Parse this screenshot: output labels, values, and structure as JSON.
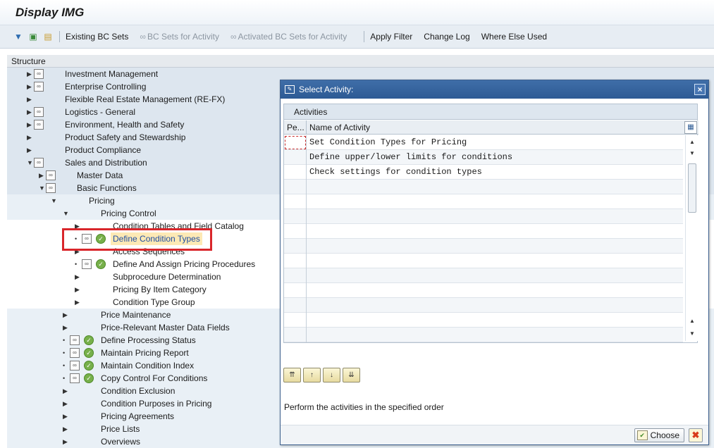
{
  "window": {
    "title": "Display IMG"
  },
  "toolbar": {
    "icons": [
      "expand-icon",
      "find-icon",
      "note-icon"
    ],
    "existing_bc_sets": "Existing BC Sets",
    "bc_sets_for_activity": "BC Sets for Activity",
    "activated_bc_sets": "Activated BC Sets for Activity",
    "apply_filter": "Apply Filter",
    "change_log": "Change Log",
    "where_else_used": "Where Else Used"
  },
  "structure": {
    "header": "Structure",
    "items": [
      {
        "label": "Investment Management",
        "level": 0,
        "icon": true,
        "exec": false,
        "expanded": false
      },
      {
        "label": "Enterprise Controlling",
        "level": 0,
        "icon": true,
        "exec": false,
        "expanded": false
      },
      {
        "label": "Flexible Real Estate Management (RE-FX)",
        "level": 0,
        "icon": false,
        "exec": false,
        "expanded": false
      },
      {
        "label": "Logistics - General",
        "level": 0,
        "icon": true,
        "exec": false,
        "expanded": false
      },
      {
        "label": "Environment, Health and Safety",
        "level": 0,
        "icon": true,
        "exec": false,
        "expanded": false
      },
      {
        "label": "Product Safety and Stewardship",
        "level": 0,
        "icon": false,
        "exec": false,
        "expanded": false
      },
      {
        "label": "Product Compliance",
        "level": 0,
        "icon": false,
        "exec": false,
        "expanded": false
      },
      {
        "label": "Sales and Distribution",
        "level": 0,
        "icon": true,
        "exec": false,
        "expanded": true
      },
      {
        "label": "Master Data",
        "level": 1,
        "icon": true,
        "exec": false,
        "expanded": false
      },
      {
        "label": "Basic Functions",
        "level": 1,
        "icon": true,
        "exec": false,
        "expanded": true
      },
      {
        "label": "Pricing",
        "level": 2,
        "icon": false,
        "exec": false,
        "expanded": true
      },
      {
        "label": "Pricing Control",
        "level": 3,
        "icon": false,
        "exec": false,
        "expanded": true
      },
      {
        "label": "Condition Tables and Field Catalog",
        "level": 4,
        "icon": false,
        "exec": false,
        "expanded": false
      },
      {
        "label": "Define Condition Types",
        "level": 4,
        "icon": true,
        "exec": true,
        "expanded": false,
        "leaf": true,
        "selected": true
      },
      {
        "label": "Access Sequences",
        "level": 4,
        "icon": false,
        "exec": false,
        "expanded": false
      },
      {
        "label": "Define And Assign Pricing Procedures",
        "level": 4,
        "icon": true,
        "exec": true,
        "expanded": false,
        "leaf": true
      },
      {
        "label": "Subprocedure Determination",
        "level": 4,
        "icon": false,
        "exec": false,
        "expanded": false
      },
      {
        "label": "Pricing By Item Category",
        "level": 4,
        "icon": false,
        "exec": false,
        "expanded": false
      },
      {
        "label": "Condition Type Group",
        "level": 4,
        "icon": false,
        "exec": false,
        "expanded": false
      },
      {
        "label": "Price Maintenance",
        "level": 3,
        "icon": false,
        "exec": false,
        "expanded": false
      },
      {
        "label": "Price-Relevant Master Data Fields",
        "level": 3,
        "icon": false,
        "exec": false,
        "expanded": false
      },
      {
        "label": "Define Processing Status",
        "level": 3,
        "icon": true,
        "exec": true,
        "expanded": false,
        "leaf": true
      },
      {
        "label": "Maintain Pricing Report",
        "level": 3,
        "icon": true,
        "exec": true,
        "expanded": false,
        "leaf": true
      },
      {
        "label": "Maintain Condition Index",
        "level": 3,
        "icon": true,
        "exec": true,
        "expanded": false,
        "leaf": true
      },
      {
        "label": "Copy Control For Conditions",
        "level": 3,
        "icon": true,
        "exec": true,
        "expanded": false,
        "leaf": true
      },
      {
        "label": "Condition Exclusion",
        "level": 3,
        "icon": false,
        "exec": false,
        "expanded": false
      },
      {
        "label": "Condition Purposes in Pricing",
        "level": 3,
        "icon": false,
        "exec": false,
        "expanded": false
      },
      {
        "label": "Pricing Agreements",
        "level": 3,
        "icon": false,
        "exec": false,
        "expanded": false
      },
      {
        "label": "Price Lists",
        "level": 3,
        "icon": false,
        "exec": false,
        "expanded": false
      },
      {
        "label": "Overviews",
        "level": 3,
        "icon": false,
        "exec": false,
        "expanded": false
      }
    ]
  },
  "dialog": {
    "title": "Select Activity:",
    "grid_title": "Activities",
    "col_pe": "Pe...",
    "col_name": "Name of Activity",
    "rows": [
      "Set Condition Types for Pricing",
      "Define upper/lower limits for conditions",
      "Check settings for condition types"
    ],
    "empty_rows": 11,
    "hint": "Perform the activities in the specified order",
    "choose": "Choose"
  }
}
